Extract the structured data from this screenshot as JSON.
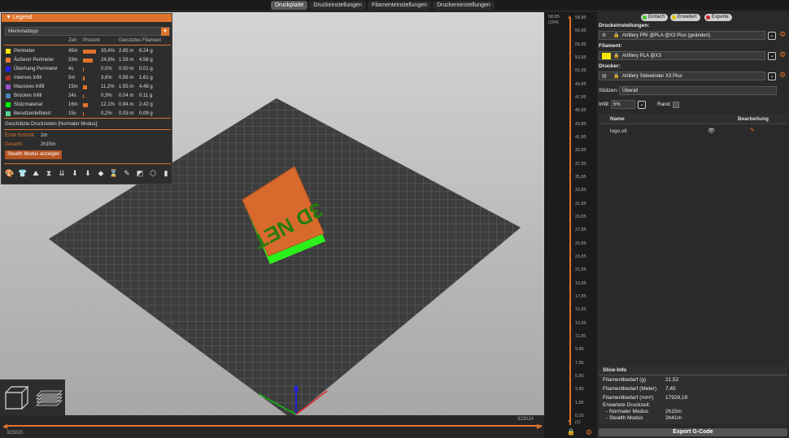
{
  "tabs": [
    "Druckplatte",
    "Druckeinstellungen",
    "Filamenteinstellungen",
    "Druckereinstellungen"
  ],
  "legend": {
    "title": "Legend",
    "type_select": "Merkmalstyp",
    "headers": {
      "time": "Zeit",
      "percent": "Prozent",
      "used": "Genutztes Filament"
    },
    "rows": [
      {
        "name": "Perimeter",
        "time": "45m",
        "percent": "33,4%",
        "pct": 33.4,
        "len": "2.85 m",
        "weight": "8.24 g",
        "color": "#ffe600"
      },
      {
        "name": "Äußerer Perimeter",
        "time": "33m",
        "percent": "24,8%",
        "pct": 24.8,
        "len": "1.58 m",
        "weight": "4.56 g",
        "color": "#ff7d38"
      },
      {
        "name": "Überhang Perimeter",
        "time": "4s",
        "percent": "0,0%",
        "pct": 0,
        "len": "0.00 m",
        "weight": "0.01 g",
        "color": "#1f1fff"
      },
      {
        "name": "Internes Infill",
        "time": "5m",
        "percent": "3,6%",
        "pct": 3.6,
        "len": "0.56 m",
        "weight": "1.61 g",
        "color": "#b03029"
      },
      {
        "name": "Massives Infill",
        "time": "15m",
        "percent": "11,2%",
        "pct": 11.2,
        "len": "1.55 m",
        "weight": "4.48 g",
        "color": "#9654cc"
      },
      {
        "name": "Brücken Infill",
        "time": "24s",
        "percent": "0,3%",
        "pct": 0.3,
        "len": "0.04 m",
        "weight": "0.11 g",
        "color": "#4d80ba"
      },
      {
        "name": "Stützmaterial",
        "time": "16m",
        "percent": "12,1%",
        "pct": 12.1,
        "len": "0.84 m",
        "weight": "2.42 g",
        "color": "#00ff00"
      },
      {
        "name": "Benutzerdefiniert",
        "time": "15s",
        "percent": "0,2%",
        "pct": 0.2,
        "len": "0.03 m",
        "weight": "0.09 g",
        "color": "#5ed194"
      }
    ],
    "estimated": "Geschätzte Druckzeiten [Normaler Modus]:",
    "first_layer_label": "Erste Schicht:",
    "first_layer": "2m",
    "total_label": "Gesamt:",
    "total": "2h15m",
    "stealth_button": "Stealth Modus anzeigen"
  },
  "view": {
    "left_num": "323020",
    "right_num": "323024",
    "model_text": "3D NET"
  },
  "vslider": {
    "top_value": "58,85",
    "top_layer": "(294)",
    "bottom_value": "0,25",
    "bottom_layer": "(1)",
    "ticks": [
      "58,85",
      "56,85",
      "55,85",
      "53,85",
      "51,85",
      "49,85",
      "47,85",
      "45,85",
      "43,85",
      "41,85",
      "39,85",
      "37,85",
      "35,85",
      "33,85",
      "31,85",
      "29,85",
      "27,85",
      "25,85",
      "23,85",
      "21,85",
      "19,85",
      "17,85",
      "15,85",
      "13,85",
      "11,85",
      "9,85",
      "7,85",
      "5,85",
      "3,85",
      "1,85",
      "0,25"
    ]
  },
  "right": {
    "modes": [
      {
        "label": "Einfach",
        "color": "#44cc22"
      },
      {
        "label": "Erweitert",
        "color": "#e8c000"
      },
      {
        "label": "Experte",
        "color": "#cc2222"
      }
    ],
    "print_settings_label": "Druckeinstellungen:",
    "print_settings": "Artillery PRI @PLA @X3 Plus (geändert)",
    "filament_label": "Filament:",
    "filament": "Artillery PLA @X3",
    "filament_color": "#f5e600",
    "printer_label": "Drucker:",
    "printer": "Artillery Sidewinder X3 Plus",
    "supports_label": "Stützen:",
    "supports": "Überall",
    "infill_label": "Infill:",
    "infill": "5%",
    "brim_label": "Rand:",
    "table": {
      "name_header": "Name",
      "edit_header": "Bearbeitung",
      "file": "logo.stl"
    },
    "slice": {
      "title": "Slice-Info",
      "rows": [
        {
          "k": "Filamentbedarf (g)",
          "v": "21,52"
        },
        {
          "k": "Filamentbedarf (Meter)",
          "v": "7,45"
        },
        {
          "k": "Filamentbedarf (mm³)",
          "v": "17929,19"
        }
      ],
      "time_label": "Erwartete Druckzeit:",
      "normal_label": "- Normaler Modus",
      "normal": "2h15m",
      "stealth_label": "- Stealth Modus",
      "stealth": "2h41m"
    },
    "export": "Export G-Code"
  }
}
